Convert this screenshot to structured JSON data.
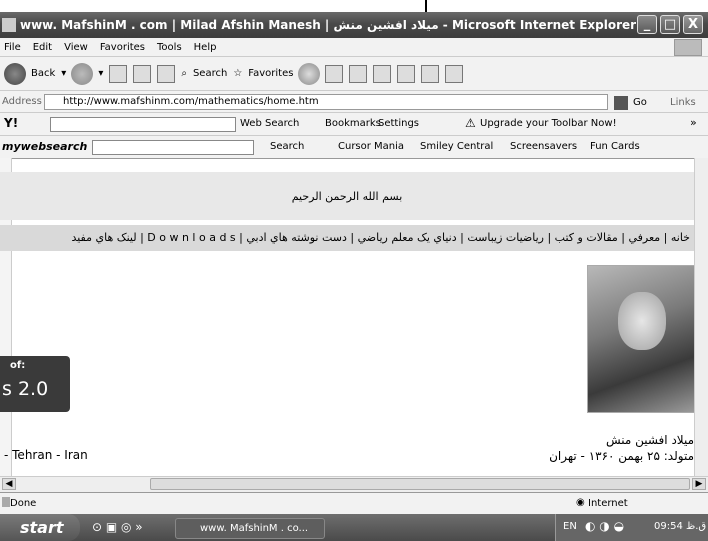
{
  "window": {
    "title": "www. MafshinM . com | Milad Afshin Manesh | ميلاد افشين منش - Microsoft Internet Explorer",
    "buttons": [
      "_",
      "□",
      "X"
    ]
  },
  "menu": [
    "File",
    "Edit",
    "View",
    "Favorites",
    "Tools",
    "Help"
  ],
  "toolbar": {
    "back": "Back",
    "search": "Search",
    "favorites": "Favorites"
  },
  "address": {
    "label": "Address",
    "url": "http://www.mafshinm.com/mathematics/home.htm",
    "go": "Go",
    "links": "Links"
  },
  "yahoo": {
    "web_search": "Web Search",
    "bookmarks": "Bookmarks",
    "settings": "Settings",
    "upgrade": "Upgrade your Toolbar Now!"
  },
  "websearch": {
    "brand": "mywebsearch",
    "search": "Search",
    "items": [
      "Cursor Mania",
      "Smiley Central",
      "Screensavers",
      "Fun Cards"
    ]
  },
  "page": {
    "basmala": "بسم الله الرحمن الرحيم",
    "nav": "خانه | معرفي | مقالات و کتب | رياضيات زيباست | دنياي يک معلم رياضي | دست نوشته هاي ادبي | D o w n l o a d s | لينک هاي مفيد",
    "badge_top": "of:",
    "badge_big": "s 2.0",
    "location_left": "- Tehran - Iran",
    "name_fa": "ميلاد افشين منش",
    "born_fa": "متولد: ۲۵ بهمن ۱۳۶۰ - تهران"
  },
  "status": {
    "text": "Done",
    "zone": "Internet"
  },
  "taskbar": {
    "start": "start",
    "app": "www. MafshinM . co...",
    "lang": "EN",
    "clock": "09:54 ق.ظ"
  }
}
